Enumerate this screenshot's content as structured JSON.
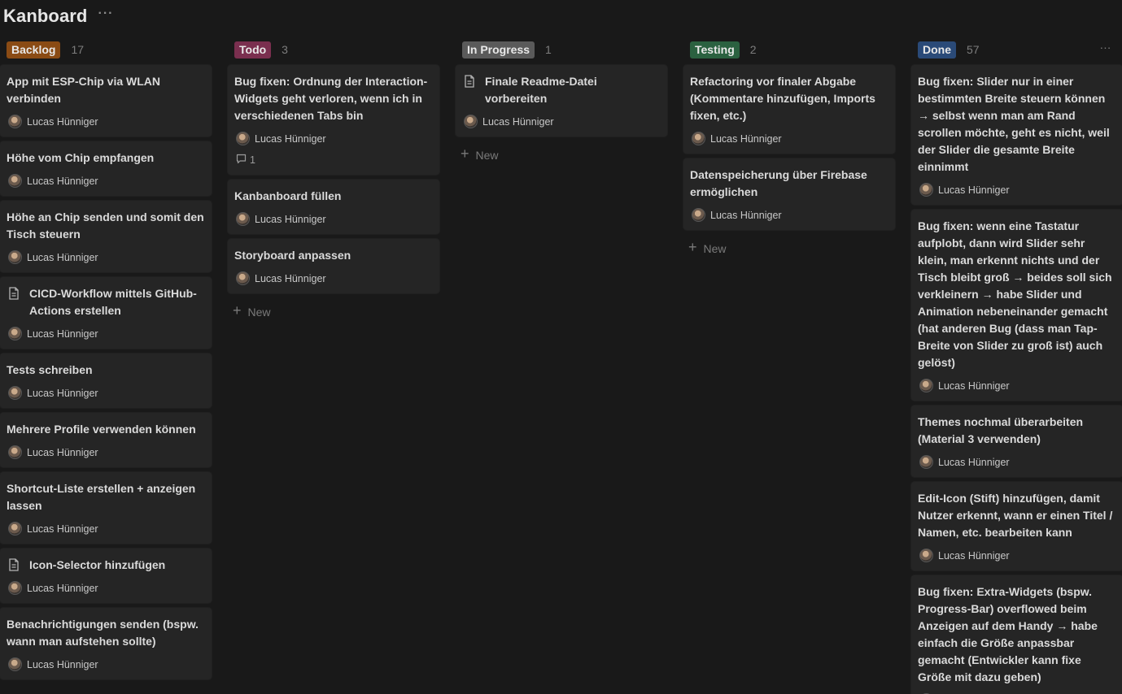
{
  "page": {
    "title": "Kanboard",
    "more_icon": "more-horizontal-icon"
  },
  "assignee_default": "Lucas Hünniger",
  "new_label": "New",
  "colors": {
    "backlog": "#8a4b14",
    "todo": "#7a2f4f",
    "inprogress": "#5a5a5a",
    "testing": "#2b6140",
    "done": "#2a4a78"
  },
  "columns": [
    {
      "id": "backlog",
      "label": "Backlog",
      "count": "17",
      "show_new": false,
      "cards": [
        {
          "title": "App mit ESP-Chip via WLAN verbinden",
          "assignee": "Lucas Hünniger",
          "doc": false
        },
        {
          "title": "Höhe vom Chip empfangen",
          "assignee": "Lucas Hünniger",
          "doc": false
        },
        {
          "title": "Höhe an Chip senden und somit den Tisch steuern",
          "assignee": "Lucas Hünniger",
          "doc": false
        },
        {
          "title": "CICD-Workflow mittels GitHub-Actions erstellen",
          "assignee": "Lucas Hünniger",
          "doc": true
        },
        {
          "title": "Tests schreiben",
          "assignee": "Lucas Hünniger",
          "doc": false
        },
        {
          "title": "Mehrere Profile verwenden können",
          "assignee": "Lucas Hünniger",
          "doc": false
        },
        {
          "title": "Shortcut-Liste erstellen + anzeigen lassen",
          "assignee": "Lucas Hünniger",
          "doc": false
        },
        {
          "title": "Icon-Selector hinzufügen",
          "assignee": "Lucas Hünniger",
          "doc": true
        },
        {
          "title": "Benachrichtigungen senden (bspw. wann man aufstehen sollte)",
          "assignee": "Lucas Hünniger",
          "doc": false
        }
      ]
    },
    {
      "id": "todo",
      "label": "Todo",
      "count": "3",
      "show_new": true,
      "cards": [
        {
          "title": "Bug fixen: Ordnung der Interaction-Widgets geht verloren, wenn ich in verschiedenen Tabs bin",
          "assignee": "Lucas Hünniger",
          "doc": false,
          "comments": "1"
        },
        {
          "title": "Kanbanboard füllen",
          "assignee": "Lucas Hünniger",
          "doc": false
        },
        {
          "title": "Storyboard anpassen",
          "assignee": "Lucas Hünniger",
          "doc": false
        }
      ]
    },
    {
      "id": "inprogress",
      "label": "In Progress",
      "count": "1",
      "show_new": true,
      "cards": [
        {
          "title": "Finale Readme-Datei vorbereiten",
          "assignee": "Lucas Hünniger",
          "doc": true
        }
      ]
    },
    {
      "id": "testing",
      "label": "Testing",
      "count": "2",
      "show_new": true,
      "cards": [
        {
          "title": "Refactoring vor finaler Abgabe (Kommentare hinzufügen, Imports fixen, etc.)",
          "assignee": "Lucas Hünniger",
          "doc": false
        },
        {
          "title": "Datenspeicherung über Firebase ermöglichen",
          "assignee": "Lucas Hünniger",
          "doc": false
        }
      ]
    },
    {
      "id": "done",
      "label": "Done",
      "count": "57",
      "show_new": false,
      "actions": true,
      "cards": [
        {
          "title": "Bug fixen: Slider nur in einer bestimmten Breite steuern können → selbst wenn man am Rand scrollen möchte, geht es nicht, weil der Slider die gesamte Breite einnimmt",
          "assignee": "Lucas Hünniger",
          "doc": false
        },
        {
          "title": "Bug fixen: wenn eine Tastatur aufplobt, dann wird Slider sehr klein, man erkennt nichts und der Tisch bleibt groß → beides soll sich verkleinern → habe Slider und Animation nebeneinander gemacht (hat anderen Bug (dass man Tap-Breite von Slider zu groß ist) auch gelöst)",
          "assignee": "Lucas Hünniger",
          "doc": false
        },
        {
          "title": "Themes nochmal überarbeiten (Material 3 verwenden)",
          "assignee": "Lucas Hünniger",
          "doc": false
        },
        {
          "title": "Edit-Icon (Stift) hinzufügen, damit Nutzer erkennt, wann er einen Titel / Namen, etc. bearbeiten kann",
          "assignee": "Lucas Hünniger",
          "doc": false
        },
        {
          "title": "Bug fixen: Extra-Widgets (bspw. Progress-Bar) overflowed beim Anzeigen auf dem Handy → habe einfach die Größe anpassbar gemacht (Entwickler kann fixe Größe mit dazu geben)",
          "assignee": "Lucas Hünniger",
          "doc": false
        }
      ]
    }
  ]
}
